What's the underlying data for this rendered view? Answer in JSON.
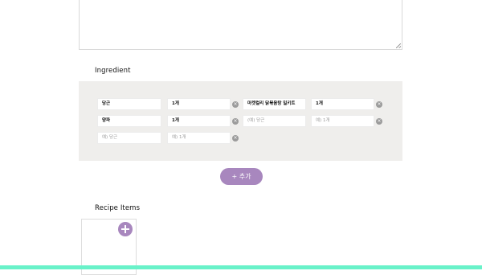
{
  "sections": {
    "ingredient_title": "Ingredient",
    "recipe_items_title": "Recipe Items"
  },
  "ingredients": [
    {
      "name": "당근",
      "amount": "1개"
    },
    {
      "name": "마켓컬리 닭볶음탕 밀키트",
      "amount": "1개"
    },
    {
      "name": "양파",
      "amount": "1개"
    },
    {
      "name": "",
      "amount": ""
    },
    {
      "name": "",
      "amount": ""
    }
  ],
  "placeholders": {
    "name_a": "(예) 당근",
    "amount_a": "예) 1개",
    "name_b": "예) 당근",
    "amount_b": "예) 1개"
  },
  "buttons": {
    "add_label": "+ 추가",
    "remove_symbol": "×"
  },
  "colors": {
    "accent": "#a887be",
    "panel": "#efeeec",
    "bottom_bar": "#69f2c9"
  }
}
